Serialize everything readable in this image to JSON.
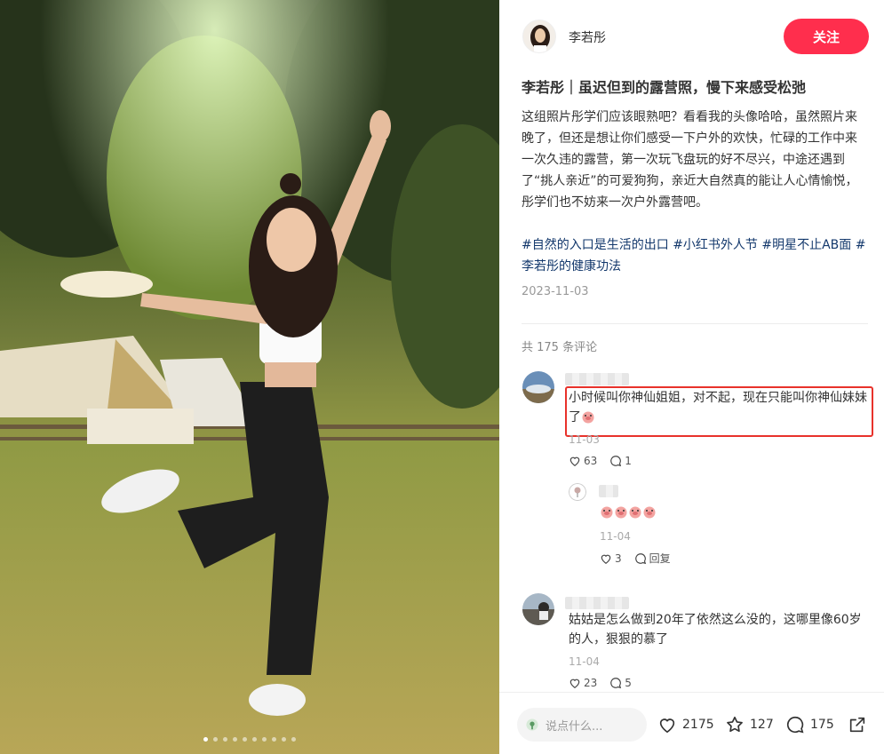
{
  "author": {
    "name": "李若彤",
    "follow_label": "关注"
  },
  "note": {
    "title": "李若彤｜虽迟但到的露营照，慢下来感受松弛",
    "desc": "这组照片彤学们应该眼熟吧？看看我的头像哈哈，虽然照片来晚了，但还是想让你们感受一下户外的欢快，忙碌的工作中来一次久违的露营，第一次玩飞盘玩的好不尽兴，中途还遇到了“挑人亲近”的可爱狗狗，亲近大自然真的能让人心情愉悦，彤学们也不妨来一次户外露营吧。",
    "tags": [
      "#自然的入口是生活的出口",
      "#小红书外人节",
      "#明星不止AB面",
      "#李若彤的健康功法"
    ],
    "date": "2023-11-03"
  },
  "comments": {
    "total_label": "共 175 条评论",
    "items": [
      {
        "text": "小时候叫你神仙姐姐，对不起，现在只能叫你神仙妹妹了",
        "date": "11-03",
        "likes": "63",
        "replies": "1"
      },
      {
        "text": "",
        "date": "11-04",
        "likes": "3",
        "reply_label": "回复"
      },
      {
        "text": "姑姑是怎么做到20年了依然这么没的，这哪里像60岁的人，狠狠的慕了",
        "date": "11-04",
        "likes": "23",
        "replies": "5"
      }
    ]
  },
  "bottom": {
    "placeholder": "说点什么...",
    "likes": "2175",
    "collects": "127",
    "comments": "175"
  },
  "carousel": {
    "count": 10,
    "active": 0
  },
  "colors": {
    "accent": "#ff2e4d",
    "tag": "#13386c",
    "highlight": "#e8322b"
  }
}
